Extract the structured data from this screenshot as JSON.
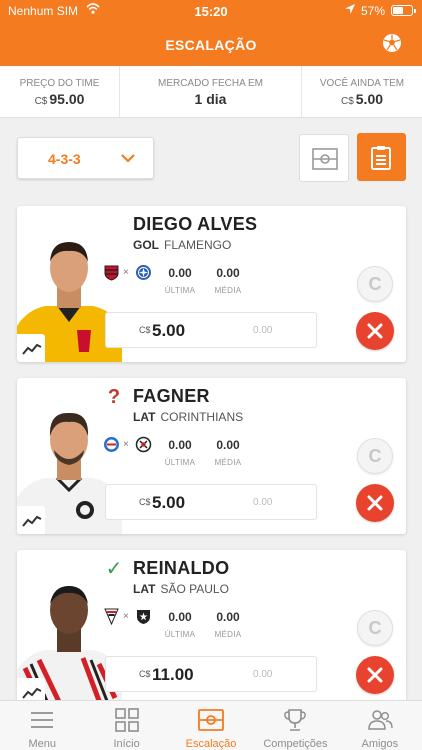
{
  "status_bar": {
    "carrier": "Nenhum SIM",
    "time": "15:20",
    "battery": "57%"
  },
  "header": {
    "title": "ESCALAÇÃO",
    "ball_icon": "soccer-ball-icon"
  },
  "summary": {
    "price": {
      "label": "PREÇO DO TIME",
      "currency": "C$",
      "value": "95.00"
    },
    "market": {
      "label": "MERCADO FECHA EM",
      "value": "1 dia"
    },
    "balance": {
      "label": "VOCÊ AINDA TEM",
      "currency": "C$",
      "value": "5.00"
    }
  },
  "formation": {
    "value": "4-3-3"
  },
  "players": [
    {
      "name": "DIEGO ALVES",
      "position": "GOL",
      "club": "FLAMENGO",
      "status": "",
      "last": "0.00",
      "last_label": "ÚLTIMA",
      "avg": "0.00",
      "avg_label": "MÉDIA",
      "currency": "C$",
      "price": "5.00",
      "variation": "0.00",
      "captain": "C",
      "home_color": "#c8102e",
      "away_color": "#2b5fb4",
      "kit_color": "#f5b800"
    },
    {
      "name": "FAGNER",
      "position": "LAT",
      "club": "CORINTHIANS",
      "status": "?",
      "last": "0.00",
      "last_label": "ÚLTIMA",
      "avg": "0.00",
      "avg_label": "MÉDIA",
      "currency": "C$",
      "price": "5.00",
      "variation": "0.00",
      "captain": "C",
      "home_color": "#2a6fc9",
      "away_color": "#222222",
      "kit_color": "#f2f2f2"
    },
    {
      "name": "REINALDO",
      "position": "LAT",
      "club": "SÃO PAULO",
      "status": "✓",
      "last": "0.00",
      "last_label": "ÚLTIMA",
      "avg": "0.00",
      "avg_label": "MÉDIA",
      "currency": "C$",
      "price": "11.00",
      "variation": "0.00",
      "captain": "C",
      "home_color": "#d32027",
      "away_color": "#222222",
      "kit_color": "#f2f2f2"
    }
  ],
  "tabs": [
    {
      "label": "Menu",
      "icon": "hamburger-icon"
    },
    {
      "label": "Início",
      "icon": "grid-icon"
    },
    {
      "label": "Escalação",
      "icon": "field-icon"
    },
    {
      "label": "Competições",
      "icon": "trophy-icon"
    },
    {
      "label": "Amigos",
      "icon": "people-icon"
    }
  ],
  "colors": {
    "brand": "#f47b20",
    "remove": "#e8432e",
    "doubt": "#c0392b",
    "probable": "#3a9a4a"
  }
}
